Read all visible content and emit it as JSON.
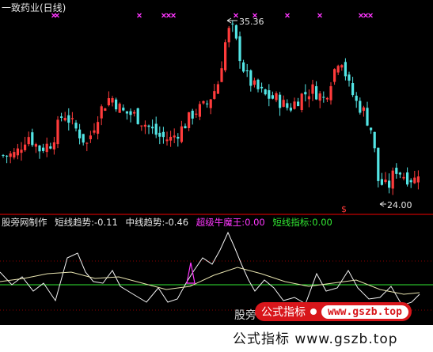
{
  "top_panel": {
    "title": "一致药业(日线)",
    "high_label": "35.36",
    "low_label": "24.00",
    "signal_marker": "$",
    "colors": {
      "up": "#ff3b3b",
      "down": "#53e5e5",
      "signal": "#ff37ff",
      "label": "#e6e6e6"
    }
  },
  "bottom_panel": {
    "source": "股旁网制作",
    "short_trend_label": "短线趋势:",
    "short_trend_value": "-0.11",
    "mid_trend_label": "中线趋势:",
    "mid_trend_value": "-0.46",
    "super_bull_label": "超级牛魔王:",
    "super_bull_value": "0.00",
    "short_index_label": "短线指标:",
    "short_index_value": "0.00",
    "colors": {
      "source": "#e6e6e6",
      "short_trend": "#e6e6e6",
      "mid_trend": "#e6e6e6",
      "super_bull": "#ff37ff",
      "short_index": "#32e632",
      "zero_line": "#32e632"
    }
  },
  "watermark": {
    "label": "公式指标",
    "url": "www.gszb.top",
    "left_text": "股旁",
    "bottom_text": "公式指标 www.gszb.top"
  },
  "chart_data": [
    {
      "type": "candlestick",
      "title": "一致药业(日线)",
      "annotations": [
        "35.36",
        "24.00"
      ],
      "high": 35.36,
      "low": 24.0
    },
    {
      "type": "line",
      "series": [
        {
          "name": "短线趋势",
          "last": -0.11
        },
        {
          "name": "中线趋势",
          "last": -0.46
        },
        {
          "name": "超级牛魔王",
          "last": 0.0
        },
        {
          "name": "短线指标",
          "last": 0.0
        }
      ]
    }
  ]
}
